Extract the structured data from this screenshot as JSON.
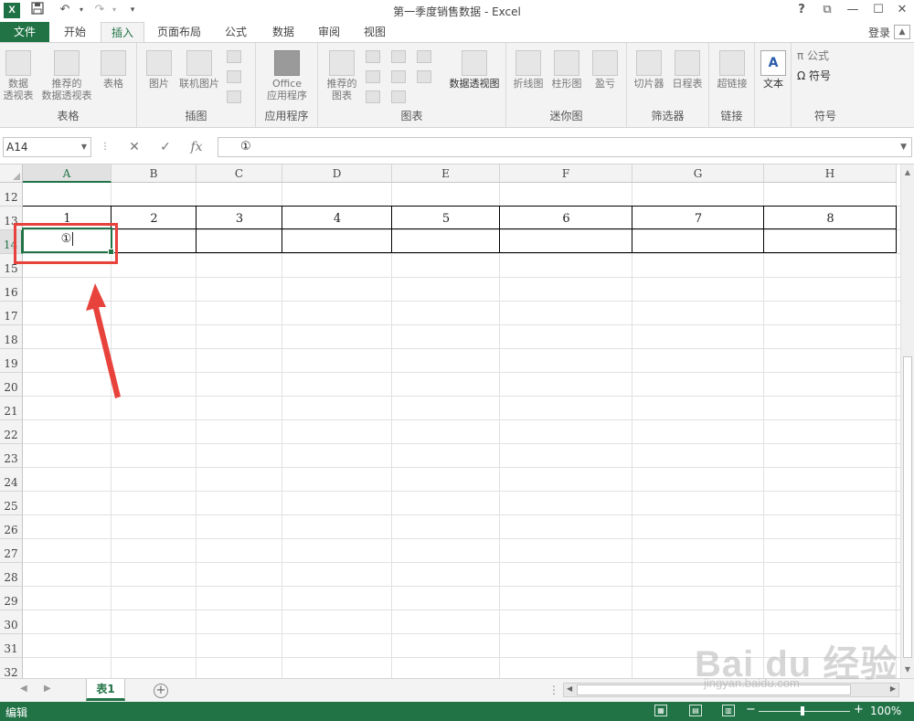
{
  "app": {
    "title": "第一季度销售数据 - Excel",
    "logo": "X",
    "undo_icon": "undo-icon",
    "redo_icon": "redo-icon"
  },
  "window": {
    "help": "?",
    "restore_ribbon": "⧉",
    "minimize": "—",
    "maximize": "☐",
    "close": "✕"
  },
  "tabs": [
    {
      "label": "文件"
    },
    {
      "label": "开始"
    },
    {
      "label": "插入"
    },
    {
      "label": "页面布局"
    },
    {
      "label": "公式"
    },
    {
      "label": "数据"
    },
    {
      "label": "审阅"
    },
    {
      "label": "视图"
    }
  ],
  "login": "登录",
  "ribbon": {
    "groups": [
      {
        "label": "表格",
        "buttons": [
          [
            "数据",
            "透视表"
          ],
          [
            "推荐的",
            "数据透视表"
          ],
          [
            "表格"
          ]
        ]
      },
      {
        "label": "插图",
        "buttons": [
          [
            "图片"
          ],
          [
            "联机图片"
          ]
        ]
      },
      {
        "label": "应用程序",
        "buttons": [
          [
            "Office",
            "应用程序"
          ]
        ]
      },
      {
        "label": "图表",
        "buttons": [
          [
            "推荐的",
            "图表"
          ],
          [
            "数据透视图"
          ]
        ]
      },
      {
        "label": "迷你图",
        "buttons": [
          [
            "折线图"
          ],
          [
            "柱形图"
          ],
          [
            "盈亏"
          ]
        ]
      },
      {
        "label": "筛选器",
        "buttons": [
          [
            "切片器"
          ],
          [
            "日程表"
          ]
        ]
      },
      {
        "label": "链接",
        "buttons": [
          [
            "超链接"
          ]
        ]
      },
      {
        "label": "",
        "buttons": [
          [
            "文本"
          ]
        ]
      },
      {
        "label": "符号",
        "buttons": [
          [
            "π 公式"
          ],
          [
            "Ω 符号"
          ]
        ]
      }
    ]
  },
  "formula_bar": {
    "name_box": "A14",
    "cancel": "✕",
    "enter": "✓",
    "fx": "fx",
    "value": "①"
  },
  "grid": {
    "columns": [
      "A",
      "B",
      "C",
      "D",
      "E",
      "F",
      "G",
      "H"
    ],
    "rows": [
      "12",
      "13",
      "14",
      "15",
      "16",
      "17",
      "18",
      "19",
      "20",
      "21",
      "22",
      "23",
      "24",
      "25",
      "26",
      "27",
      "28",
      "29",
      "30",
      "31",
      "32"
    ],
    "row13_values": [
      "1",
      "2",
      "3",
      "4",
      "5",
      "6",
      "7",
      "8"
    ],
    "active_cell_value": "①",
    "selected_column": "A",
    "selected_row": "14"
  },
  "sheets": [
    {
      "name": "表1"
    }
  ],
  "add_sheet": "+",
  "status": {
    "mode": "编辑",
    "zoom": "100%",
    "zoom_minus": "−",
    "zoom_plus": "+"
  },
  "watermark": {
    "text": "Bai du 经验",
    "url": "jingyan.baidu.com"
  },
  "annotation": {
    "highlight_color": "#e8423c"
  },
  "colors": {
    "excel_green": "#217346"
  }
}
